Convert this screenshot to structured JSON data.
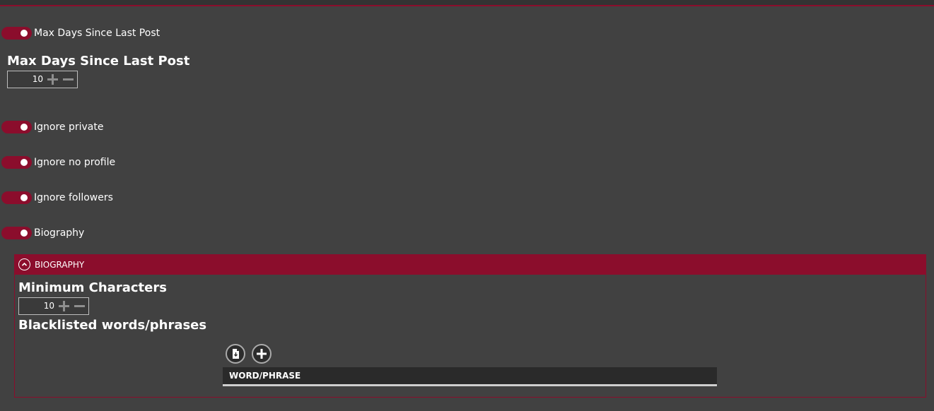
{
  "colors": {
    "accent": "#8b0d2c",
    "background": "#414141",
    "text": "#ffffff"
  },
  "toggles": {
    "max_days": {
      "label": "Max Days Since Last Post",
      "on": true
    },
    "ignore_private": {
      "label": "Ignore private",
      "on": true
    },
    "ignore_no_profile": {
      "label": "Ignore no profile",
      "on": true
    },
    "ignore_followers": {
      "label": "Ignore followers",
      "on": true
    },
    "biography": {
      "label": "Biography",
      "on": true
    }
  },
  "max_days": {
    "heading": "Max Days Since Last Post",
    "value": "10"
  },
  "biography_panel": {
    "title": "BIOGRAPHY",
    "collapse_icon": "chevron-up-circle-icon",
    "min_chars": {
      "heading": "Minimum Characters",
      "value": "10"
    },
    "blacklist": {
      "heading": "Blacklisted words/phrases",
      "import_icon": "import-file-icon",
      "add_icon": "add-circle-icon",
      "column_header": "WORD/PHRASE"
    }
  }
}
